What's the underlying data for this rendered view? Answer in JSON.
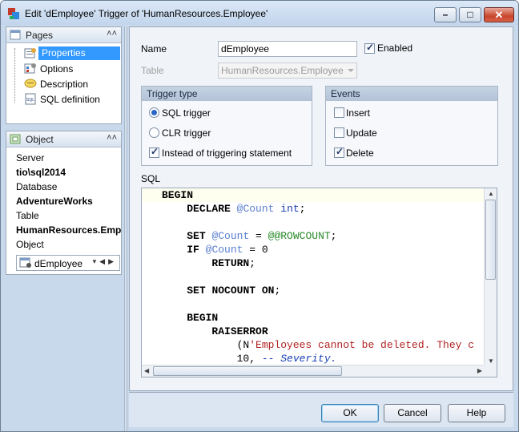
{
  "window": {
    "title": "Edit 'dEmployee' Trigger of 'HumanResources.Employee'",
    "buttons": {
      "minimize": "–",
      "maximize": "□",
      "close": "✕"
    }
  },
  "pages_panel": {
    "title": "Pages",
    "items": [
      {
        "label": "Properties",
        "icon": "properties-icon",
        "selected": true
      },
      {
        "label": "Options",
        "icon": "options-icon",
        "selected": false
      },
      {
        "label": "Description",
        "icon": "description-icon",
        "selected": false
      },
      {
        "label": "SQL definition",
        "icon": "sql-icon",
        "selected": false
      }
    ]
  },
  "object_panel": {
    "title": "Object",
    "server_label": "Server",
    "server_value": "tio\\sql2014",
    "database_label": "Database",
    "database_value": "AdventureWorks",
    "table_label": "Table",
    "table_value": "HumanResources.Employee",
    "object_label": "Object",
    "object_value": "dEmployee"
  },
  "form": {
    "name_label": "Name",
    "name_value": "dEmployee",
    "enabled_label": "Enabled",
    "enabled": true,
    "table_label": "Table",
    "table_value": "HumanResources.Employee"
  },
  "trigger_type": {
    "title": "Trigger type",
    "sql_trigger": "SQL trigger",
    "clr_trigger": "CLR trigger",
    "instead_of": "Instead of triggering statement",
    "selected": "sql",
    "instead_checked": true
  },
  "events": {
    "title": "Events",
    "insert": "Insert",
    "update": "Update",
    "delete": "Delete",
    "insert_checked": false,
    "update_checked": false,
    "delete_checked": true
  },
  "sql": {
    "label": "SQL",
    "lines": [
      "BEGIN",
      "    DECLARE @Count int;",
      "",
      "    SET @Count = @@ROWCOUNT;",
      "    IF @Count = 0",
      "        RETURN;",
      "",
      "    SET NOCOUNT ON;",
      "",
      "    BEGIN",
      "        RAISERROR",
      "            (N'Employees cannot be deleted. They c",
      "            10, -- Severity."
    ]
  },
  "footer": {
    "ok": "OK",
    "cancel": "Cancel",
    "help": "Help"
  },
  "colors": {
    "accent": "#3399ff",
    "title_bg": "#c2d5ec"
  }
}
